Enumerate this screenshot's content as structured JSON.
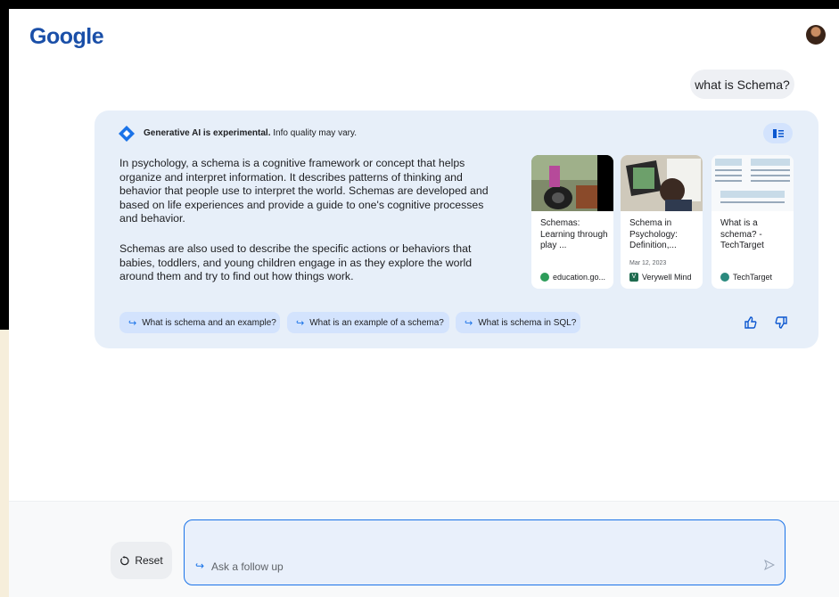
{
  "header": {
    "logo": "Google"
  },
  "query": "what is Schema?",
  "card": {
    "disclaimer_bold": "Generative AI is experimental.",
    "disclaimer_rest": " Info quality may vary.",
    "paragraphs": [
      "In psychology, a schema is a cognitive framework or concept that helps organize and interpret information. It describes patterns of thinking and behavior that people use to interpret the world. Schemas are developed and based on life experiences and provide a guide to one's cognitive processes and behavior.",
      "Schemas are also used to describe the specific actions or behaviors that babies, toddlers, and young children engage in as they explore the world around them and try to find out how things work."
    ],
    "sources": [
      {
        "title": "Schemas: Learning through play ...",
        "date": "",
        "site": "education.go...",
        "favicon_color": "#2e9d5a"
      },
      {
        "title": "Schema in Psychology: Definition,...",
        "date": "Mar 12, 2023",
        "site": "Verywell Mind",
        "favicon_color": "#1f6b4f"
      },
      {
        "title": "What is a schema? - TechTarget",
        "date": "",
        "site": "TechTarget",
        "favicon_color": "#2b8a7e"
      }
    ],
    "chips": [
      "What is schema and an example?",
      "What is an example of a schema?",
      "What is schema in SQL?"
    ]
  },
  "footer": {
    "reset_label": "Reset",
    "followup_placeholder": "Ask a follow up"
  },
  "colors": {
    "accent": "#1a73e8",
    "card_bg": "#e7eff9",
    "chip_bg": "#d3e3fd"
  }
}
